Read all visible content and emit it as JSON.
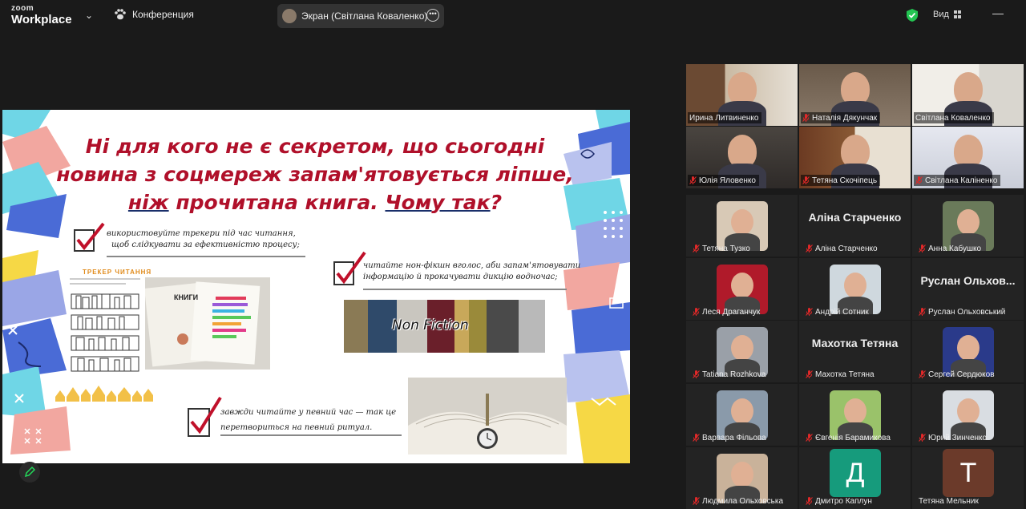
{
  "topbar": {
    "logo_line1": "zoom",
    "logo_line2": "Workplace",
    "meeting_label": "Конференция",
    "share_label": "Экран (Світлана Коваленко)",
    "view_label": "Вид",
    "minimize": "—"
  },
  "slide": {
    "title_parts": [
      "Ні для кого не є секретом, що сьогодні новина з соцмереж запам'ятовується ліпше, ",
      "ніж",
      " прочитана книга. ",
      "Чому так",
      "?"
    ],
    "tips": [
      {
        "l1": "використовуйте трекери під час читання,",
        "l2": "щоб слідкувати за ефективністю процесу;"
      },
      {
        "l1": "читайте нон-фікшн вголос, аби запам'ятовувати",
        "l2": "інформацію й прокачувати дикцію водночас;"
      },
      {
        "l1": "завжди читайте у певний час — так це",
        "l2": "перетвориться на певний ритуал."
      }
    ],
    "tracker_title": "ТРЕКЕР ЧИТАННЯ",
    "book_label": "КНИГИ",
    "nonfiction_label": "Non Fiction"
  },
  "gallery": {
    "tiles": [
      {
        "name": "Ирина Литвиненко",
        "kind": "video",
        "muted": false,
        "active": false
      },
      {
        "name": "Наталія Дякунчак",
        "kind": "video",
        "muted": true,
        "active": false
      },
      {
        "name": "Світлана Коваленко",
        "kind": "video",
        "muted": false,
        "active": true
      },
      {
        "name": "Юлія Яловенко",
        "kind": "video",
        "muted": true,
        "active": false
      },
      {
        "name": "Тетяна Скочіпець",
        "kind": "video",
        "muted": true,
        "active": false
      },
      {
        "name": "Світлана Каліненко",
        "kind": "video",
        "muted": true,
        "active": false
      },
      {
        "name": "Тетяна Тузко",
        "kind": "avatar",
        "muted": true,
        "active": false
      },
      {
        "name": "Аліна Старченко",
        "kind": "text",
        "bigname": "Аліна Старченко",
        "muted": true,
        "active": false
      },
      {
        "name": "Анна Кабушко",
        "kind": "avatar",
        "muted": true,
        "active": false
      },
      {
        "name": "Леся Драганчук",
        "kind": "avatar",
        "muted": true,
        "active": false
      },
      {
        "name": "Андрій Сотник",
        "kind": "avatar",
        "muted": true,
        "active": false
      },
      {
        "name": "Руслан Ольховський",
        "kind": "text",
        "bigname": "Руслан Ольхов...",
        "muted": true,
        "active": false
      },
      {
        "name": "Tatiana Rozhkova",
        "kind": "avatar",
        "muted": true,
        "active": false
      },
      {
        "name": "Махотка Тетяна",
        "kind": "text",
        "bigname": "Махотка Тетяна",
        "muted": true,
        "active": false
      },
      {
        "name": "Сергей Сердюков",
        "kind": "avatar",
        "muted": true,
        "active": false
      },
      {
        "name": "Варвара Фільова",
        "kind": "avatar",
        "muted": true,
        "active": false
      },
      {
        "name": "Євгенія Барамикова",
        "kind": "avatar",
        "muted": true,
        "active": false
      },
      {
        "name": "Юрий Зинченко",
        "kind": "avatar",
        "muted": true,
        "active": false
      },
      {
        "name": "Людмила Ольховська",
        "kind": "avatar",
        "muted": true,
        "active": false
      },
      {
        "name": "Дмитро Каплун",
        "kind": "letter",
        "letter": "Д",
        "muted": true,
        "active": false
      },
      {
        "name": "Тетяна Мельник",
        "kind": "letter",
        "letter": "Т",
        "muted": false,
        "active": false
      }
    ]
  },
  "colors": {
    "active_border": "#23d959",
    "title_red": "#b0102a",
    "letter_tile_d": "#169b7c",
    "letter_tile_t": "#6b3a2a"
  }
}
